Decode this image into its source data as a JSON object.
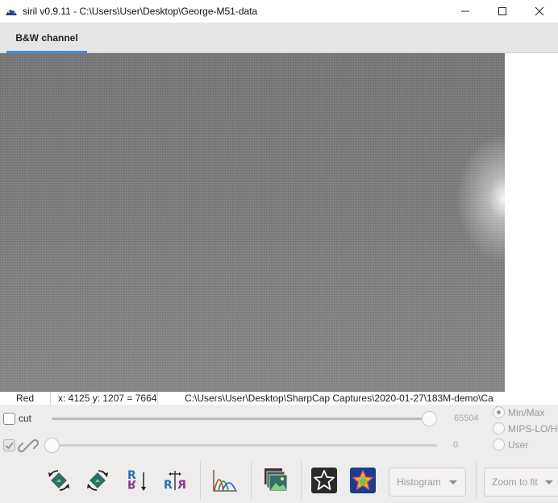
{
  "window": {
    "title": "siril v0.9.11 - C:\\Users\\User\\Desktop\\George-M51-data",
    "controls": [
      "minimize-icon",
      "maximize-icon",
      "close-icon"
    ]
  },
  "tabs": [
    {
      "label": "B&W channel",
      "active": true
    }
  ],
  "statusbar": {
    "channel": "Red",
    "coords": "x: 4125 y: 1207 = 7664",
    "path": "C:\\Users\\User\\Desktop\\SharpCap Captures\\2020-01-27\\183M-demo\\Ca"
  },
  "controls": {
    "cut_label": "cut",
    "cut_checked": false,
    "link_checked": true,
    "hi_value": "65504",
    "lo_value": "0",
    "hi_level": 1.0,
    "lo_level": 0.0,
    "radio_options": [
      {
        "label": "Min/Max",
        "selected": true
      },
      {
        "label": "MIPS-LO/HI",
        "selected": false
      },
      {
        "label": "User",
        "selected": false
      }
    ]
  },
  "toolbar": {
    "buttons": [
      "rotate-left-icon",
      "rotate-right-icon",
      "mirror-x-icon",
      "mirror-y-icon",
      "histogram-curve-icon",
      "image-stack-icon",
      "star-outline-icon",
      "star-color-icon"
    ],
    "display_mode": "Histogram",
    "zoom": "Zoom to fit"
  },
  "colors": {
    "tab_accent": "#3d8ee0",
    "image_bg": "#7d7d7d"
  }
}
